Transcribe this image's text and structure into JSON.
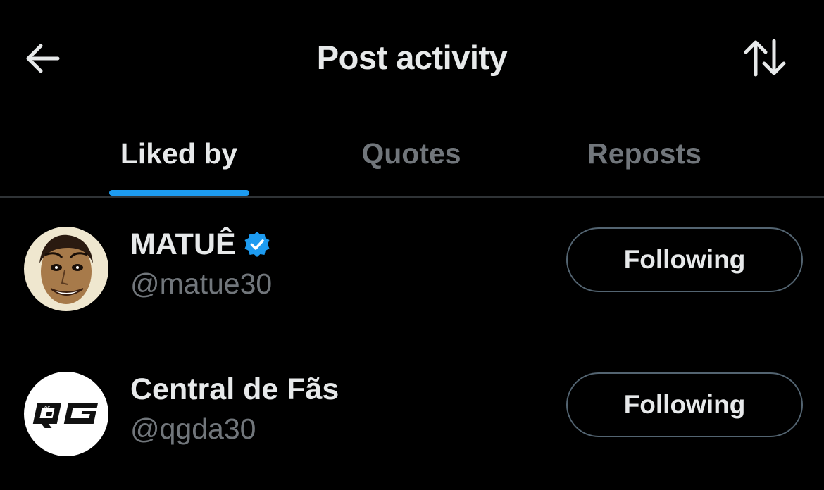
{
  "header": {
    "title": "Post activity",
    "back_icon": "arrow-left-icon",
    "sort_icon": "sort-arrows-icon"
  },
  "tabs": [
    {
      "label": "Liked by",
      "active": true
    },
    {
      "label": "Quotes",
      "active": false
    },
    {
      "label": "Reposts",
      "active": false
    }
  ],
  "users": [
    {
      "name": "MATUÊ",
      "handle": "@matue30",
      "verified": true,
      "button_label": "Following",
      "avatar": "face-illustration"
    },
    {
      "name": "Central de Fãs",
      "handle": "@qgda30",
      "verified": false,
      "button_label": "Following",
      "avatar": "qg-logo",
      "avatar_text": "QG"
    }
  ],
  "colors": {
    "background": "#000000",
    "text_primary": "#e7e9ea",
    "text_secondary": "#71767b",
    "accent": "#1d9bf0",
    "divider": "#2f3336"
  }
}
